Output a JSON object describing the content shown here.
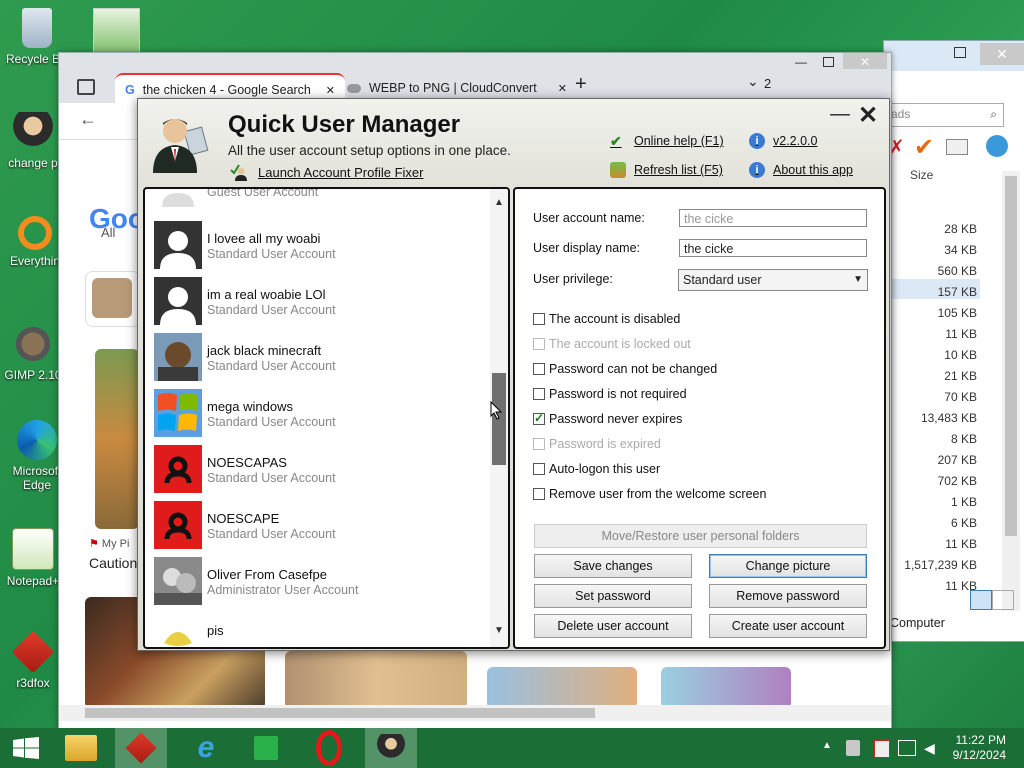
{
  "desktop": {
    "icons": [
      {
        "label": "Recycle Bin"
      },
      {
        "label": "change p"
      },
      {
        "label": "Everythin"
      },
      {
        "label": "GIMP 2.10"
      },
      {
        "label": "Microsoft Edge"
      },
      {
        "label": "Notepad+"
      },
      {
        "label": "r3dfox"
      }
    ]
  },
  "browser": {
    "tabs": [
      {
        "title": "the chicken 4 - Google Search",
        "close": "✕"
      },
      {
        "title": "WEBP to PNG | CloudConvert",
        "close": "✕"
      }
    ],
    "new_tab": "+",
    "tab_count": "2",
    "google_text": "Goo",
    "all_tab": "All",
    "card_source": "My Pi",
    "card_caption": "Caution"
  },
  "explorer": {
    "search_placeholder": "ads",
    "size_header": "Size",
    "sizes": [
      "28 KB",
      "34 KB",
      "560 KB",
      "157 KB",
      "105 KB",
      "11 KB",
      "10 KB",
      "21 KB",
      "70 KB",
      "13,483 KB",
      "8 KB",
      "207 KB",
      "702 KB",
      "1 KB",
      "6 KB",
      "11 KB",
      "1,517,239 KB",
      "11 KB"
    ],
    "computer_label": "Computer"
  },
  "qum": {
    "title": "Quick User Manager",
    "subtitle": "All the user account setup options in one place.",
    "fixer_link": "Launch Account Profile Fixer",
    "help_link": "Online help (F1)",
    "refresh_link": "Refresh list (F5)",
    "version_link": "v2.2.0.0",
    "about_link": "About this app",
    "minimize": "—",
    "close": "✕",
    "users": [
      {
        "name": "Guest",
        "type": "Guest User Account"
      },
      {
        "name": "I lovee all my woabi",
        "type": "Standard User Account"
      },
      {
        "name": "im a real woabie LOl",
        "type": "Standard User Account"
      },
      {
        "name": "jack black minecraft",
        "type": "Standard User Account"
      },
      {
        "name": "mega windows",
        "type": "Standard User Account"
      },
      {
        "name": "NOESCAPAS",
        "type": "Standard User Account"
      },
      {
        "name": "NOESCAPE",
        "type": "Standard User Account"
      },
      {
        "name": "Oliver From Casefpe",
        "type": "Administrator User Account"
      },
      {
        "name": "pis",
        "type": ""
      }
    ],
    "details": {
      "account_name_label": "User account name:",
      "account_name_value": "the cicke",
      "display_name_label": "User display name:",
      "display_name_value": "the cicke",
      "privilege_label": "User privilege:",
      "privilege_value": "Standard user",
      "checkboxes": [
        {
          "label": "The account is disabled",
          "checked": false,
          "disabled": false
        },
        {
          "label": "The account is locked out",
          "checked": false,
          "disabled": true
        },
        {
          "label": "Password can not be changed",
          "checked": false,
          "disabled": false
        },
        {
          "label": "Password is not required",
          "checked": false,
          "disabled": false
        },
        {
          "label": "Password never expires",
          "checked": true,
          "disabled": false
        },
        {
          "label": "Password is expired",
          "checked": false,
          "disabled": true
        },
        {
          "label": "Auto-logon this user",
          "checked": false,
          "disabled": false
        },
        {
          "label": "Remove user from the welcome screen",
          "checked": false,
          "disabled": false
        }
      ],
      "btn_move": "Move/Restore user personal folders",
      "btn_save": "Save changes",
      "btn_change_picture": "Change picture",
      "btn_set_password": "Set password",
      "btn_remove_password": "Remove password",
      "btn_delete": "Delete user account",
      "btn_create": "Create user account"
    }
  },
  "taskbar": {
    "time": "11:22 PM",
    "date": "9/12/2024"
  }
}
